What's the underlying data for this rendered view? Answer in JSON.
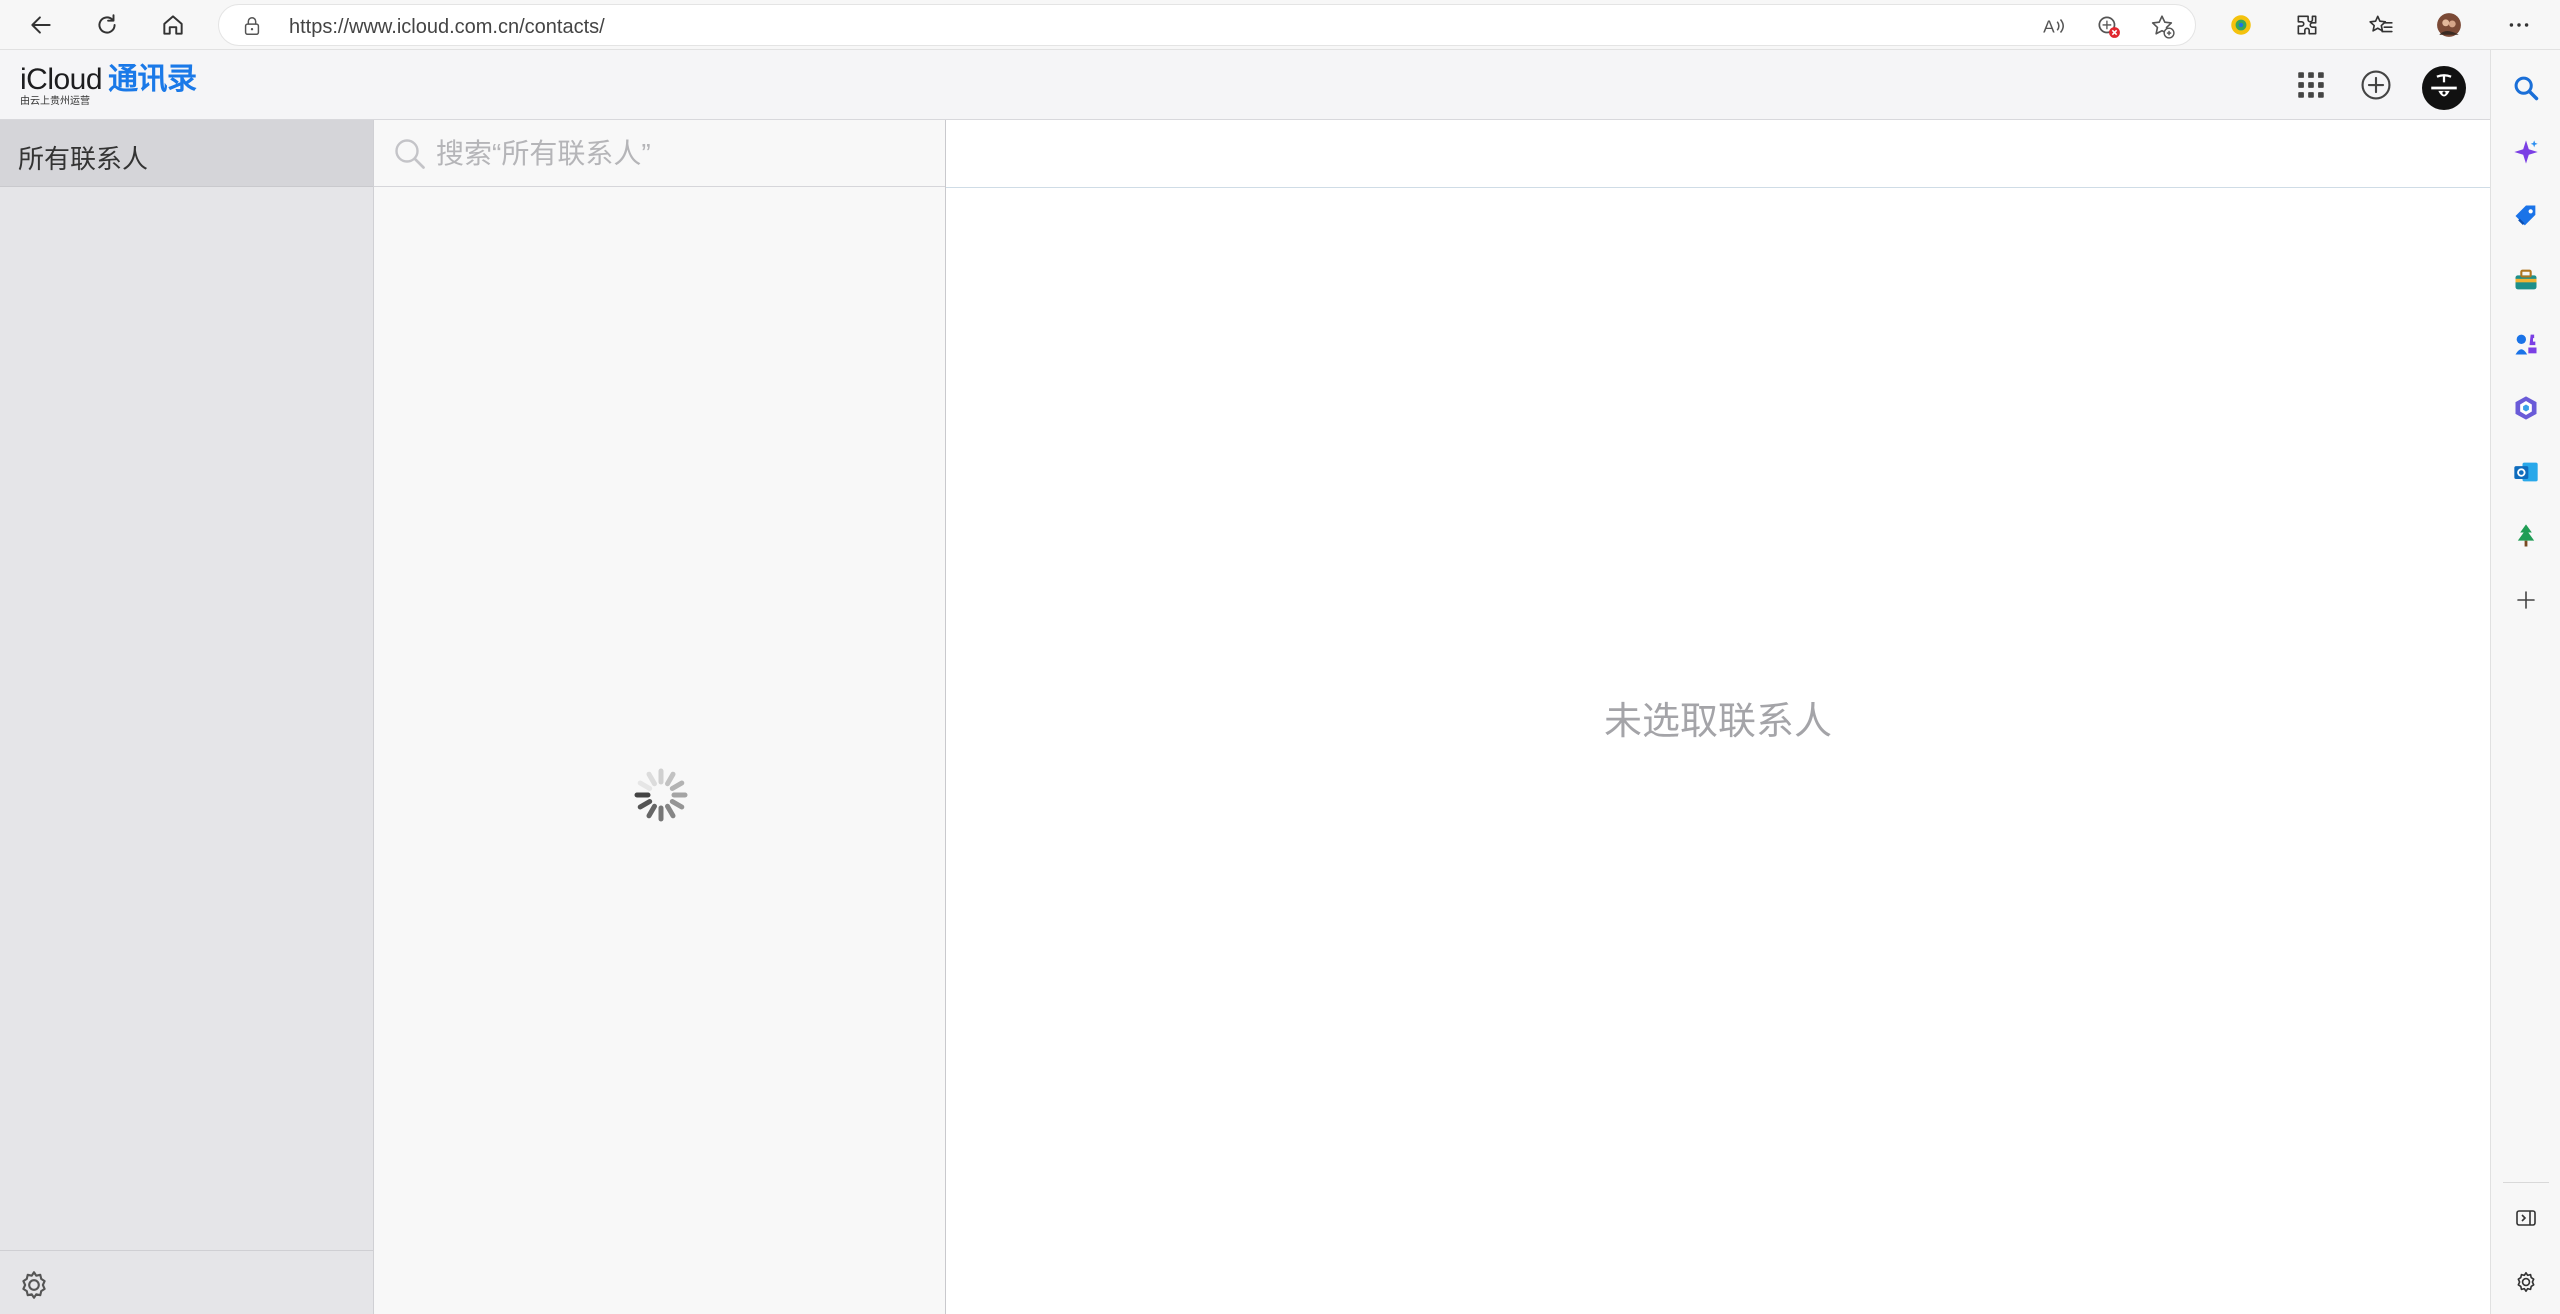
{
  "browser": {
    "url": "https://www.icloud.com.cn/contacts/"
  },
  "app": {
    "logo_brand": "iCloud",
    "logo_app": "通讯录",
    "logo_subtitle": "由云上贵州运营",
    "colors": {
      "accent": "#1a79e8",
      "sidebar_bg": "#e5e5e8",
      "list_bg": "#f8f8f8"
    }
  },
  "sidebar": {
    "group_label": "所有联系人"
  },
  "search": {
    "placeholder": "搜索“所有联系人”"
  },
  "detail": {
    "empty_message": "未选取联系人"
  },
  "icons": {
    "toolbar": [
      "back-icon",
      "refresh-icon",
      "home-icon",
      "lock-icon",
      "read-aloud-icon",
      "tracking-prevention-icon",
      "add-favorite-icon",
      "extension-icon",
      "extensions-icon",
      "favorites-icon",
      "profile-icon",
      "more-icon"
    ],
    "header": [
      "app-grid-icon",
      "add-icon",
      "account-avatar-icon"
    ],
    "edge_sidebar": [
      "search-icon",
      "copilot-icon",
      "shopping-icon",
      "tools-icon",
      "games-icon",
      "microsoft365-icon",
      "outlook-icon",
      "tree-icon",
      "add-icon",
      "hide-sidebar-icon",
      "settings-icon"
    ]
  }
}
